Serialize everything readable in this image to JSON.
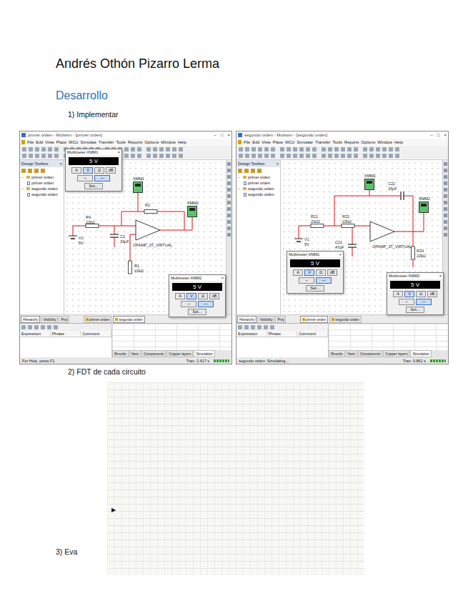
{
  "document": {
    "author": "Andrés Othón Pizarro Lerma",
    "heading": "Desarrollo",
    "sections": [
      {
        "label": "1) Implementar"
      },
      {
        "label": "2) FDT de cada circuito"
      },
      {
        "label": "3) Eva"
      }
    ]
  },
  "screenshot": {
    "windows": [
      {
        "title": "primer orden - Multisim - [primer orden]",
        "controls": [
          "–",
          "□",
          "×"
        ],
        "menu": [
          "File",
          "Edit",
          "View",
          "Place",
          "MCU",
          "Simulate",
          "Transfer",
          "Tools",
          "Reports",
          "Options",
          "Window",
          "Help"
        ],
        "toolbox": {
          "title": "Design Toolbox",
          "close": "×",
          "tree": [
            {
              "label": "primer orden",
              "expanded": true,
              "children": [
                {
                  "label": "primer orden"
                }
              ]
            },
            {
              "label": "segundo orden",
              "expanded": true,
              "children": [
                {
                  "label": "segundo orden"
                }
              ]
            }
          ],
          "tabs": [
            {
              "label": "Hierarchy",
              "selected": true
            },
            {
              "label": "Visibility",
              "selected": false
            },
            {
              "label": "Proj",
              "selected": false
            }
          ]
        },
        "design_tabs": [
          {
            "label": "primer orden",
            "selected": false
          },
          {
            "label": "segundo orden",
            "selected": true
          }
        ],
        "parts": [
          {
            "label": "R4",
            "value": "22kΩ"
          },
          {
            "label": "R2"
          },
          {
            "label": "V1",
            "value": "5V"
          },
          {
            "label": "C2",
            "value": "33pF"
          },
          {
            "label": "OPAMP_3T_VIRTUAL"
          },
          {
            "label": "R1",
            "value": "22kΩ"
          }
        ],
        "instruments": [
          {
            "label": "XMM1"
          },
          {
            "label": "XMM2"
          }
        ],
        "meters": [
          {
            "title": "Multimeter-XMM1",
            "close": "×",
            "reading": "5 V",
            "modes": [
              {
                "label": "A",
                "selected": false
              },
              {
                "label": "V",
                "selected": true
              },
              {
                "label": "Ω",
                "selected": false
              },
              {
                "label": "dB",
                "selected": false
              }
            ],
            "waves": [
              {
                "label": "~",
                "selected": false
              },
              {
                "label": "—",
                "selected": true
              }
            ],
            "button": "Set..."
          },
          {
            "title": "Multimeter-XMM2",
            "close": "×",
            "reading": "5 V",
            "modes": [
              {
                "label": "A",
                "selected": false
              },
              {
                "label": "V",
                "selected": true
              },
              {
                "label": "Ω",
                "selected": false
              },
              {
                "label": "dB",
                "selected": false
              }
            ],
            "waves": [
              {
                "label": "~",
                "selected": false
              },
              {
                "label": "—",
                "selected": true
              }
            ],
            "button": "Set..."
          }
        ],
        "spreadsheet": {
          "columns": [
            "Expression",
            "Phrase",
            "Comment"
          ],
          "tabs": [
            {
              "label": "Results",
              "selected": false
            },
            {
              "label": "Nets",
              "selected": false
            },
            {
              "label": "Components",
              "selected": false
            },
            {
              "label": "Copper layers",
              "selected": false
            },
            {
              "label": "Simulation",
              "selected": true
            }
          ]
        },
        "status": {
          "left": "For Help, press F1",
          "right": "Tran: 2.417 s"
        }
      },
      {
        "title": "segundo orden - Multisim - [segundo orden]",
        "controls": [
          "–",
          "□",
          "×"
        ],
        "menu": [
          "File",
          "Edit",
          "View",
          "Place",
          "MCU",
          "Simulate",
          "Transfer",
          "Tools",
          "Reports",
          "Options",
          "Window",
          "Help"
        ],
        "toolbox": {
          "title": "Design Toolbox",
          "close": "×",
          "tree": [
            {
              "label": "primer orden",
              "expanded": true,
              "children": [
                {
                  "label": "primer orden"
                }
              ]
            },
            {
              "label": "segundo orden",
              "expanded": true,
              "children": [
                {
                  "label": "segundo orden"
                }
              ]
            }
          ],
          "tabs": [
            {
              "label": "Hierarchy",
              "selected": true
            },
            {
              "label": "Visibility",
              "selected": false
            },
            {
              "label": "Proj",
              "selected": false
            }
          ]
        },
        "design_tabs": [
          {
            "label": "primer orden",
            "selected": true
          },
          {
            "label": "segundo orden",
            "selected": false
          }
        ],
        "parts": [
          {
            "label": "R21",
            "value": "22kΩ"
          },
          {
            "label": "R22",
            "value": "22kΩ"
          },
          {
            "label": "V1",
            "value": "5V"
          },
          {
            "label": "C22",
            "value": "33pF"
          },
          {
            "label": "C21",
            "value": "47pF"
          },
          {
            "label": "OPAMP_3T_VIRTUAL"
          },
          {
            "label": "R24",
            "value": "22kΩ"
          }
        ],
        "instruments": [
          {
            "label": "XMM1"
          },
          {
            "label": "XMM2"
          }
        ],
        "meters": [
          {
            "title": "Multimeter-XMM1",
            "close": "×",
            "reading": "5 V",
            "modes": [
              {
                "label": "A",
                "selected": false
              },
              {
                "label": "V",
                "selected": true
              },
              {
                "label": "Ω",
                "selected": false
              },
              {
                "label": "dB",
                "selected": false
              }
            ],
            "waves": [
              {
                "label": "~",
                "selected": false
              },
              {
                "label": "—",
                "selected": true
              }
            ],
            "button": "Set..."
          },
          {
            "title": "Multimeter-XMM2",
            "close": "×",
            "reading": "5 V",
            "modes": [
              {
                "label": "A",
                "selected": false
              },
              {
                "label": "V",
                "selected": true
              },
              {
                "label": "Ω",
                "selected": false
              },
              {
                "label": "dB",
                "selected": false
              }
            ],
            "waves": [
              {
                "label": "~",
                "selected": false
              },
              {
                "label": "—",
                "selected": true
              }
            ],
            "button": "Set..."
          }
        ],
        "spreadsheet": {
          "columns": [
            "Expression",
            "Phrase",
            "Comment"
          ],
          "tabs": [
            {
              "label": "Results",
              "selected": false
            },
            {
              "label": "Nets",
              "selected": false
            },
            {
              "label": "Components",
              "selected": false
            },
            {
              "label": "Copper layers",
              "selected": false
            },
            {
              "label": "Simulation",
              "selected": true
            }
          ]
        },
        "status": {
          "left": "segundo orden: Simulating...",
          "right": "Tran: 0.862 s"
        }
      }
    ]
  },
  "notes": {
    "marker": "▶"
  }
}
